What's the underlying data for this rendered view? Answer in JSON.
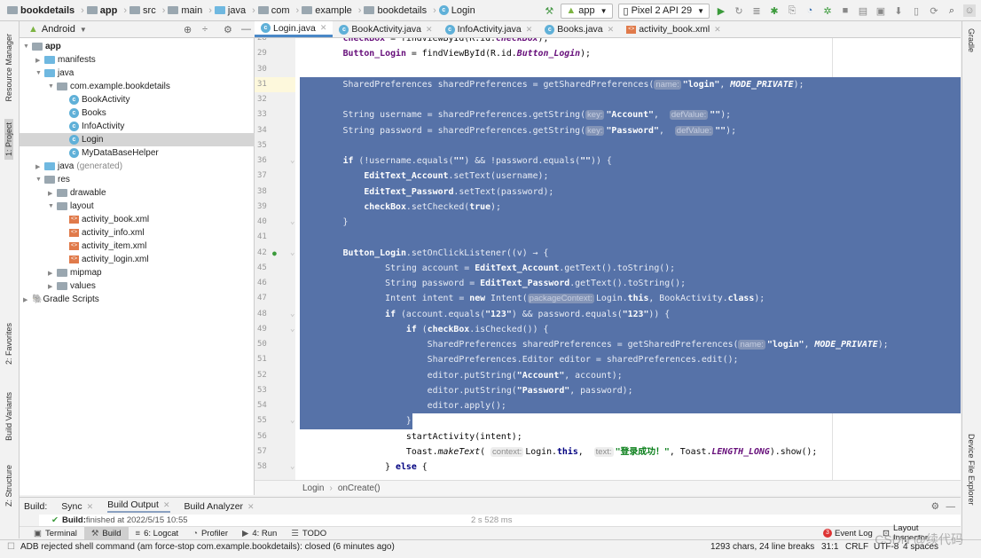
{
  "breadcrumb": [
    "bookdetails",
    "app",
    "src",
    "main",
    "java",
    "com",
    "example",
    "bookdetails",
    "Login"
  ],
  "toolbar": {
    "config": "app",
    "device": "Pixel 2 API 29",
    "icons": [
      "hammer-icon",
      "run-icon",
      "rerun-icon",
      "apply-changes-icon",
      "debug-icon",
      "attach-icon",
      "profiler-icon",
      "debug-attach-icon",
      "stop-icon",
      "project-structure-icon",
      "avd-icon",
      "sdk-icon",
      "device-manager-icon",
      "sync-icon",
      "search-icon",
      "user-icon"
    ]
  },
  "left_strip": [
    "Resource Manager",
    "1: Project",
    "2: Favorites",
    "Build Variants",
    "Z: Structure"
  ],
  "right_strip": [
    "Gradle",
    "Device File Explorer"
  ],
  "project": {
    "view": "Android",
    "tree": [
      {
        "label": "app",
        "level": 0,
        "arrow": "down",
        "icon": "module",
        "bold": true
      },
      {
        "label": "manifests",
        "level": 1,
        "arrow": "right",
        "icon": "folder-blue"
      },
      {
        "label": "java",
        "level": 1,
        "arrow": "down",
        "icon": "folder-blue"
      },
      {
        "label": "com.example.bookdetails",
        "level": 2,
        "arrow": "down",
        "icon": "package"
      },
      {
        "label": "BookActivity",
        "level": 3,
        "icon": "class"
      },
      {
        "label": "Books",
        "level": 3,
        "icon": "class"
      },
      {
        "label": "InfoActivity",
        "level": 3,
        "icon": "class"
      },
      {
        "label": "Login",
        "level": 3,
        "icon": "class",
        "selected": true
      },
      {
        "label": "MyDataBaseHelper",
        "level": 3,
        "icon": "class"
      },
      {
        "label": "java",
        "suffix": "(generated)",
        "level": 1,
        "arrow": "right",
        "icon": "folder-blue"
      },
      {
        "label": "res",
        "level": 1,
        "arrow": "down",
        "icon": "folder"
      },
      {
        "label": "drawable",
        "level": 2,
        "arrow": "right",
        "icon": "package"
      },
      {
        "label": "layout",
        "level": 2,
        "arrow": "down",
        "icon": "package"
      },
      {
        "label": "activity_book.xml",
        "level": 3,
        "icon": "xml"
      },
      {
        "label": "activity_info.xml",
        "level": 3,
        "icon": "xml"
      },
      {
        "label": "activity_item.xml",
        "level": 3,
        "icon": "xml"
      },
      {
        "label": "activity_login.xml",
        "level": 3,
        "icon": "xml"
      },
      {
        "label": "mipmap",
        "level": 2,
        "arrow": "right",
        "icon": "package"
      },
      {
        "label": "values",
        "level": 2,
        "arrow": "right",
        "icon": "package"
      },
      {
        "label": "Gradle Scripts",
        "level": 0,
        "arrow": "right",
        "icon": "gradle"
      }
    ]
  },
  "tabs": [
    {
      "label": "Login.java",
      "icon": "class",
      "active": true
    },
    {
      "label": "BookActivity.java",
      "icon": "class"
    },
    {
      "label": "InfoActivity.java",
      "icon": "class"
    },
    {
      "label": "Books.java",
      "icon": "class"
    },
    {
      "label": "activity_book.xml",
      "icon": "xml"
    }
  ],
  "editor": {
    "current_line": 31,
    "selection": {
      "from": 31,
      "to": 55
    },
    "lines": [
      {
        "n": 28,
        "s": [
          [
            "        "
          ],
          [
            "checkBox",
            "f"
          ],
          [
            " = findViewById(R.id."
          ],
          [
            "checkBox",
            "i"
          ],
          [
            ");"
          ]
        ]
      },
      {
        "n": 29,
        "s": [
          [
            "        "
          ],
          [
            "Button_Login",
            "f"
          ],
          [
            " = findViewById(R.id."
          ],
          [
            "Button_Login",
            "i"
          ],
          [
            ");"
          ]
        ]
      },
      {
        "n": 30,
        "s": []
      },
      {
        "n": 31,
        "s": [
          [
            "        SharedPreferences sharedPreferences = getSharedPreferences("
          ],
          [
            "name:",
            "h"
          ],
          [
            "\"login\"",
            "s"
          ],
          [
            ", "
          ],
          [
            "MODE_PRIVATE",
            "i"
          ],
          [
            ");"
          ]
        ]
      },
      {
        "n": 32,
        "s": []
      },
      {
        "n": 33,
        "s": [
          [
            "        String username = sharedPreferences.getString("
          ],
          [
            "key:",
            "h"
          ],
          [
            "\"Account\"",
            "s"
          ],
          [
            ",  "
          ],
          [
            "defValue:",
            "h"
          ],
          [
            "\"\"",
            "s"
          ],
          [
            ");"
          ]
        ]
      },
      {
        "n": 34,
        "s": [
          [
            "        String password = sharedPreferences.getString("
          ],
          [
            "key:",
            "h"
          ],
          [
            "\"Password\"",
            "s"
          ],
          [
            ",  "
          ],
          [
            "defValue:",
            "h"
          ],
          [
            "\"\"",
            "s"
          ],
          [
            ");"
          ]
        ]
      },
      {
        "n": 35,
        "s": []
      },
      {
        "n": 36,
        "s": [
          [
            "        "
          ],
          [
            "if",
            "k"
          ],
          [
            " (!username.equals("
          ],
          [
            "\"\"",
            "s"
          ],
          [
            ") && !password.equals("
          ],
          [
            "\"\"",
            "s"
          ],
          [
            ")) {"
          ]
        ]
      },
      {
        "n": 37,
        "s": [
          [
            "            "
          ],
          [
            "EditText_Account",
            "f"
          ],
          [
            ".setText(username);"
          ]
        ]
      },
      {
        "n": 38,
        "s": [
          [
            "            "
          ],
          [
            "EditText_Password",
            "f"
          ],
          [
            ".setText(password);"
          ]
        ]
      },
      {
        "n": 39,
        "s": [
          [
            "            "
          ],
          [
            "checkBox",
            "f"
          ],
          [
            ".setChecked("
          ],
          [
            "true",
            "k"
          ],
          [
            ");"
          ]
        ]
      },
      {
        "n": 40,
        "s": [
          [
            "        }"
          ]
        ]
      },
      {
        "n": 41,
        "s": []
      },
      {
        "n": 42,
        "s": [
          [
            "        "
          ],
          [
            "Button_Login",
            "f"
          ],
          [
            ".setOnClickListener((v) → {"
          ]
        ]
      },
      {
        "n": 45,
        "s": [
          [
            "                String account = "
          ],
          [
            "EditText_Account",
            "f"
          ],
          [
            ".getText().toString();"
          ]
        ]
      },
      {
        "n": 46,
        "s": [
          [
            "                String password = "
          ],
          [
            "EditText_Password",
            "f"
          ],
          [
            ".getText().toString();"
          ]
        ]
      },
      {
        "n": 47,
        "s": [
          [
            "                Intent intent = "
          ],
          [
            "new",
            "k"
          ],
          [
            " Intent("
          ],
          [
            "packageContext:",
            "h"
          ],
          [
            "Login."
          ],
          [
            "this",
            "k"
          ],
          [
            ", BookActivity."
          ],
          [
            "class",
            "k"
          ],
          [
            ");"
          ]
        ]
      },
      {
        "n": 48,
        "s": [
          [
            "                "
          ],
          [
            "if",
            "k"
          ],
          [
            " (account.equals("
          ],
          [
            "\"123\"",
            "s"
          ],
          [
            ") && password.equals("
          ],
          [
            "\"123\"",
            "s"
          ],
          [
            ")) {"
          ]
        ]
      },
      {
        "n": 49,
        "s": [
          [
            "                    "
          ],
          [
            "if",
            "k"
          ],
          [
            " ("
          ],
          [
            "checkBox",
            "f"
          ],
          [
            ".isChecked()) {"
          ]
        ]
      },
      {
        "n": 50,
        "s": [
          [
            "                        SharedPreferences sharedPreferences = getSharedPreferences("
          ],
          [
            "name:",
            "h"
          ],
          [
            "\"login\"",
            "s"
          ],
          [
            ", "
          ],
          [
            "MODE_PRIVATE",
            "i"
          ],
          [
            ");"
          ]
        ]
      },
      {
        "n": 51,
        "s": [
          [
            "                        SharedPreferences.Editor editor = sharedPreferences.edit();"
          ]
        ]
      },
      {
        "n": 52,
        "s": [
          [
            "                        editor.putString("
          ],
          [
            "\"Account\"",
            "s"
          ],
          [
            ", account);"
          ]
        ]
      },
      {
        "n": 53,
        "s": [
          [
            "                        editor.putString("
          ],
          [
            "\"Password\"",
            "s"
          ],
          [
            ", password);"
          ]
        ]
      },
      {
        "n": 54,
        "s": [
          [
            "                        editor.apply();"
          ]
        ]
      },
      {
        "n": 55,
        "s": [
          [
            "                    }"
          ]
        ]
      },
      {
        "n": 56,
        "s": [
          [
            "                    startActivity(intent);"
          ]
        ]
      },
      {
        "n": 57,
        "s": [
          [
            "                    Toast."
          ],
          [
            "makeText",
            "m"
          ],
          [
            "( "
          ],
          [
            "context:",
            "h"
          ],
          [
            "Login."
          ],
          [
            "this",
            "k"
          ],
          [
            ",  "
          ],
          [
            "text:",
            "h"
          ],
          [
            "\"登录成功！\"",
            "s"
          ],
          [
            ", Toast."
          ],
          [
            "LENGTH_LONG",
            "i"
          ],
          [
            ").show();"
          ]
        ]
      },
      {
        "n": 58,
        "s": [
          [
            "                } "
          ],
          [
            "else",
            "k"
          ],
          [
            " {"
          ]
        ]
      }
    ]
  },
  "editor_breadcrumb": [
    "Login",
    "onCreate()"
  ],
  "build": {
    "label": "Build:",
    "tabs": [
      "Sync",
      "Build Output",
      "Build Analyzer"
    ],
    "active_tab": "Build Output",
    "message_bold": "Build:",
    "message": " finished at 2022/5/15 10:55",
    "duration": "2 s 528 ms"
  },
  "toolwindows": [
    {
      "label": "Terminal",
      "icon": "terminal-icon"
    },
    {
      "label": "Build",
      "icon": "hammer-icon",
      "active": true
    },
    {
      "label": "6: Logcat",
      "icon": "logcat-icon"
    },
    {
      "label": "Profiler",
      "icon": "profiler-icon"
    },
    {
      "label": "4: Run",
      "icon": "run-icon"
    },
    {
      "label": "TODO",
      "icon": "todo-icon"
    }
  ],
  "event_log": {
    "label": "Event Log",
    "count": "3"
  },
  "layout_inspector": "Layout Inspector",
  "status": {
    "message": "ADB rejected shell command (am force-stop com.example.bookdetails): closed (6 minutes ago)",
    "chars": "1293 chars, 24 line breaks",
    "position": "31:1",
    "line_sep": "CRLF",
    "encoding": "UTF-8",
    "indent": "4 spaces"
  },
  "watermark": "CSDN @续代码",
  "colors": {
    "selection": "#5672a8",
    "keyword": "#000080",
    "field": "#660e7a",
    "string": "#067d17",
    "tab_underline": "#4a88c7"
  }
}
